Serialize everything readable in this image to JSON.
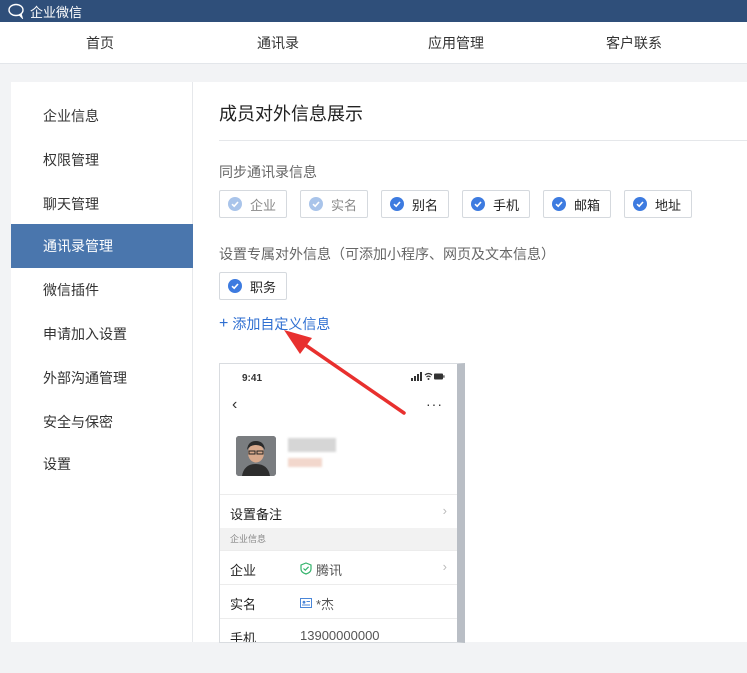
{
  "app": {
    "title": "企业微信"
  },
  "nav": {
    "items": [
      "首页",
      "通讯录",
      "应用管理",
      "客户联系"
    ]
  },
  "sidebar": {
    "items": [
      "企业信息",
      "权限管理",
      "聊天管理",
      "通讯录管理",
      "微信插件",
      "申请加入设置",
      "外部沟通管理",
      "安全与保密",
      "设置"
    ],
    "active": "通讯录管理"
  },
  "main": {
    "title": "成员对外信息展示",
    "sync_label": "同步通讯录信息",
    "sync_chips": [
      {
        "label": "企业",
        "checked": true,
        "editable": false
      },
      {
        "label": "实名",
        "checked": true,
        "editable": false
      },
      {
        "label": "别名",
        "checked": true,
        "editable": true
      },
      {
        "label": "手机",
        "checked": true,
        "editable": true
      },
      {
        "label": "邮箱",
        "checked": true,
        "editable": true
      },
      {
        "label": "地址",
        "checked": true,
        "editable": true
      }
    ],
    "custom_label": "设置专属对外信息（可添加小程序、网页及文本信息）",
    "custom_chips": [
      {
        "label": "职务",
        "checked": true,
        "editable": true
      }
    ],
    "add_link": "添加自定义信息"
  },
  "phone_preview": {
    "time": "9:41",
    "remark_label": "设置备注",
    "group_label": "企业信息",
    "rows": [
      {
        "key": "企业",
        "value": "腾讯"
      },
      {
        "key": "实名",
        "value": "*杰"
      },
      {
        "key": "手机",
        "value": "13900000000"
      }
    ]
  },
  "colors": {
    "titlebar": "#2f4f7a",
    "active_sidebar": "#4a76ad",
    "link": "#2f6fd1",
    "check": "#3d7be0",
    "arrow": "#e8302e"
  }
}
